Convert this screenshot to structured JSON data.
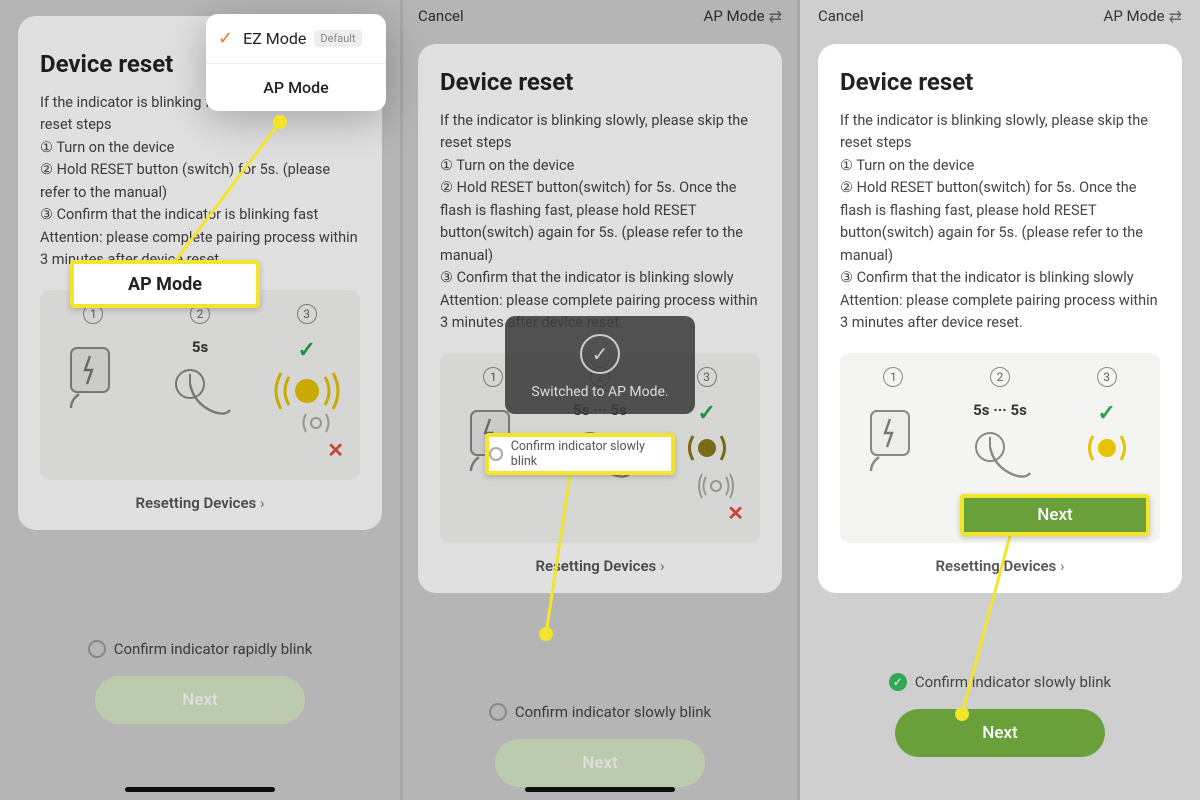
{
  "common": {
    "cancel": "Cancel",
    "mode_label": "AP Mode",
    "title": "Device reset",
    "reset_link": "Resetting Devices",
    "next": "Next",
    "timing_short": "5s",
    "timing_dual": "5s ··· 5s",
    "diagram_steps": [
      "1",
      "2",
      "3"
    ]
  },
  "dropdown": {
    "ez": "EZ Mode",
    "default": "Default",
    "ap": "AP Mode"
  },
  "toast": {
    "msg": "Switched to AP Mode."
  },
  "hl": {
    "s1": "AP Mode",
    "s2": "Confirm indicator slowly blink",
    "s3": "Next"
  },
  "screen1": {
    "body1": "If the indicator is blinking fast, please skip the reset steps",
    "body2": "① Turn on the device",
    "body3": "② Hold RESET button (switch) for 5s. (please refer to the manual)",
    "body4": "③ Confirm that the indicator is blinking fast",
    "body5": "Attention: please complete pairing process within 3 minutes after device reset.",
    "confirm": "Confirm indicator rapidly blink"
  },
  "screen2": {
    "body1": "If the indicator is blinking slowly,  please skip the reset steps",
    "body2": "① Turn on the device",
    "body3": "② Hold RESET button(switch) for 5s. Once the flash is flashing fast, please hold RESET button(switch) again for 5s. (please refer to the manual)",
    "body4": "③ Confirm that the indicator is blinking slowly",
    "body5": "Attention: please complete pairing process within 3 minutes after device reset.",
    "confirm": "Confirm indicator slowly blink"
  },
  "screen3": {
    "body1": "If the indicator is blinking slowly,  please skip the reset steps",
    "body2": "① Turn on the device",
    "body3": "② Hold RESET button(switch) for 5s. Once the flash is flashing fast, please hold RESET button(switch) again for 5s. (please refer to the manual)",
    "body4": "③ Confirm that the indicator is blinking slowly",
    "body5": "Attention: please complete pairing process within 3 minutes after device reset.",
    "confirm": "Confirm indicator slowly blink"
  }
}
